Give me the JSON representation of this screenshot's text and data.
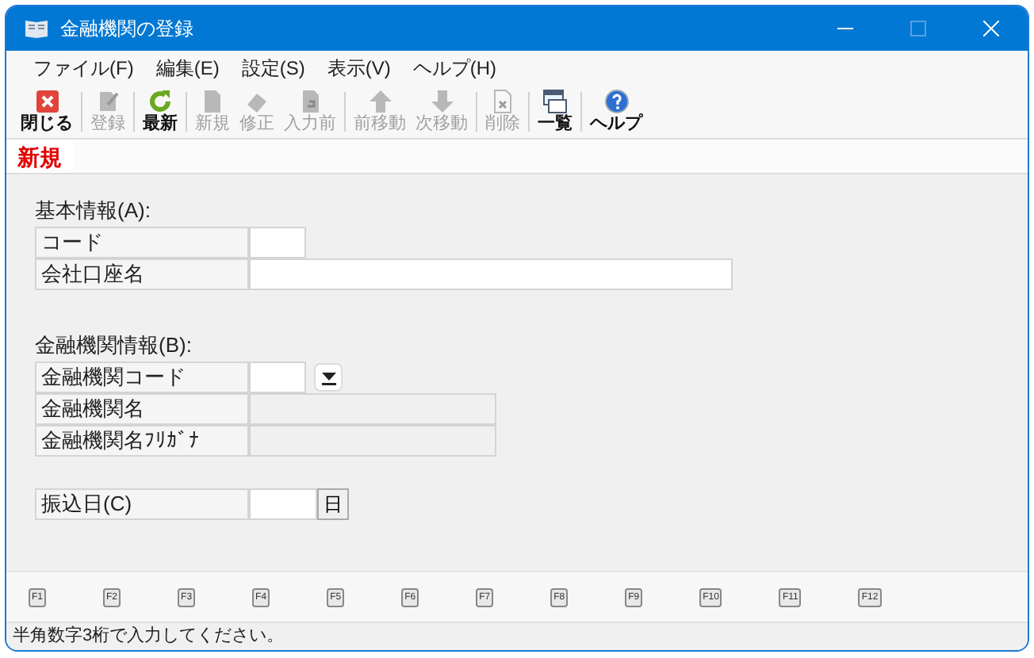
{
  "window": {
    "title": "金融機関の登録"
  },
  "menu": [
    "ファイル(F)",
    "編集(E)",
    "設定(S)",
    "表示(V)",
    "ヘルプ(H)"
  ],
  "toolbar_groups": [
    [
      {
        "label": "閉じる",
        "kind": "close",
        "disabled": false
      }
    ],
    [
      {
        "label": "登録",
        "kind": "register",
        "disabled": true
      }
    ],
    [
      {
        "label": "最新",
        "kind": "refresh",
        "disabled": false
      }
    ],
    [
      {
        "label": "新規",
        "kind": "new",
        "disabled": true
      },
      {
        "label": "修正",
        "kind": "edit",
        "disabled": true
      },
      {
        "label": "入力前",
        "kind": "undo",
        "disabled": true
      }
    ],
    [
      {
        "label": "前移動",
        "kind": "up",
        "disabled": true
      },
      {
        "label": "次移動",
        "kind": "down",
        "disabled": true
      }
    ],
    [
      {
        "label": "削除",
        "kind": "delete",
        "disabled": true
      }
    ],
    [
      {
        "label": "一覧",
        "kind": "list",
        "disabled": false
      }
    ],
    [
      {
        "label": "ヘルプ",
        "kind": "help",
        "disabled": false
      }
    ]
  ],
  "mode_tab": {
    "label": "新規"
  },
  "sections": [
    {
      "heading": "基本情報(A):",
      "rows": [
        {
          "label": "コード",
          "kind": "short",
          "disabled": false
        },
        {
          "label": "会社口座名",
          "kind": "long",
          "disabled": false
        }
      ]
    },
    {
      "heading": "金融機関情報(B):",
      "rows": [
        {
          "label": "金融機関コード",
          "kind": "dropdown",
          "disabled": false
        },
        {
          "label": "金融機関名",
          "kind": "medium",
          "disabled": true
        },
        {
          "label": "金融機関名ﾌﾘｶﾞﾅ",
          "kind": "medium",
          "disabled": true
        }
      ]
    },
    {
      "rows": [
        {
          "label": "振込日(C)",
          "kind": "date",
          "disabled": false,
          "button": "日"
        }
      ]
    }
  ],
  "function_keys": [
    "F1",
    "F2",
    "F3",
    "F4",
    "F5",
    "F6",
    "F7",
    "F8",
    "F9",
    "F10",
    "F11",
    "F12"
  ],
  "status_bar": "半角数字3桁で入力してください。"
}
